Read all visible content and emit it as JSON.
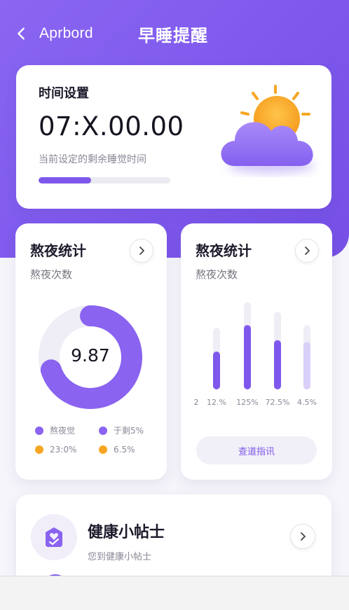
{
  "header": {
    "back_label": "Aprbord",
    "title": "早睡提醒"
  },
  "time_card": {
    "title": "时间设置",
    "time": "07:X.00.00",
    "caption": "当前设定的剩余睡觉时间",
    "progress_fraction": 0.4,
    "icon": "sun-cloud-icon"
  },
  "stats_left": {
    "title": "熬夜统计",
    "subtitle": "熬夜次数",
    "value": "9.87",
    "donut_fraction": 0.7,
    "legend": [
      {
        "label": "熬夜觉",
        "color": "#8a63f0"
      },
      {
        "label": "于剩5%",
        "color": "#8a63f0"
      },
      {
        "label": "23:0%",
        "color": "#f6a623"
      },
      {
        "label": "6.5%",
        "color": "#f6a623"
      }
    ]
  },
  "stats_right": {
    "title": "熬夜统计",
    "subtitle": "熬夜次数",
    "bars": [
      {
        "label": "12.%",
        "track": 0.65,
        "value": 0.4,
        "light": false
      },
      {
        "label": "125%",
        "track": 0.92,
        "value": 0.68,
        "light": false
      },
      {
        "label": "72.5%",
        "track": 0.82,
        "value": 0.52,
        "light": false
      },
      {
        "label": "4.5%",
        "track": 0.68,
        "value": 0.5,
        "light": true
      }
    ],
    "edge_label": "2",
    "button_label": "查道指讯"
  },
  "tips": {
    "title": "健康小帖士",
    "subtitle": "您到健康小帖士",
    "icon": "heart-check-icon"
  },
  "colors": {
    "accent": "#7e58ec",
    "accent_light": "#d9cff8",
    "orange": "#f6a623",
    "track": "#efedf5"
  }
}
